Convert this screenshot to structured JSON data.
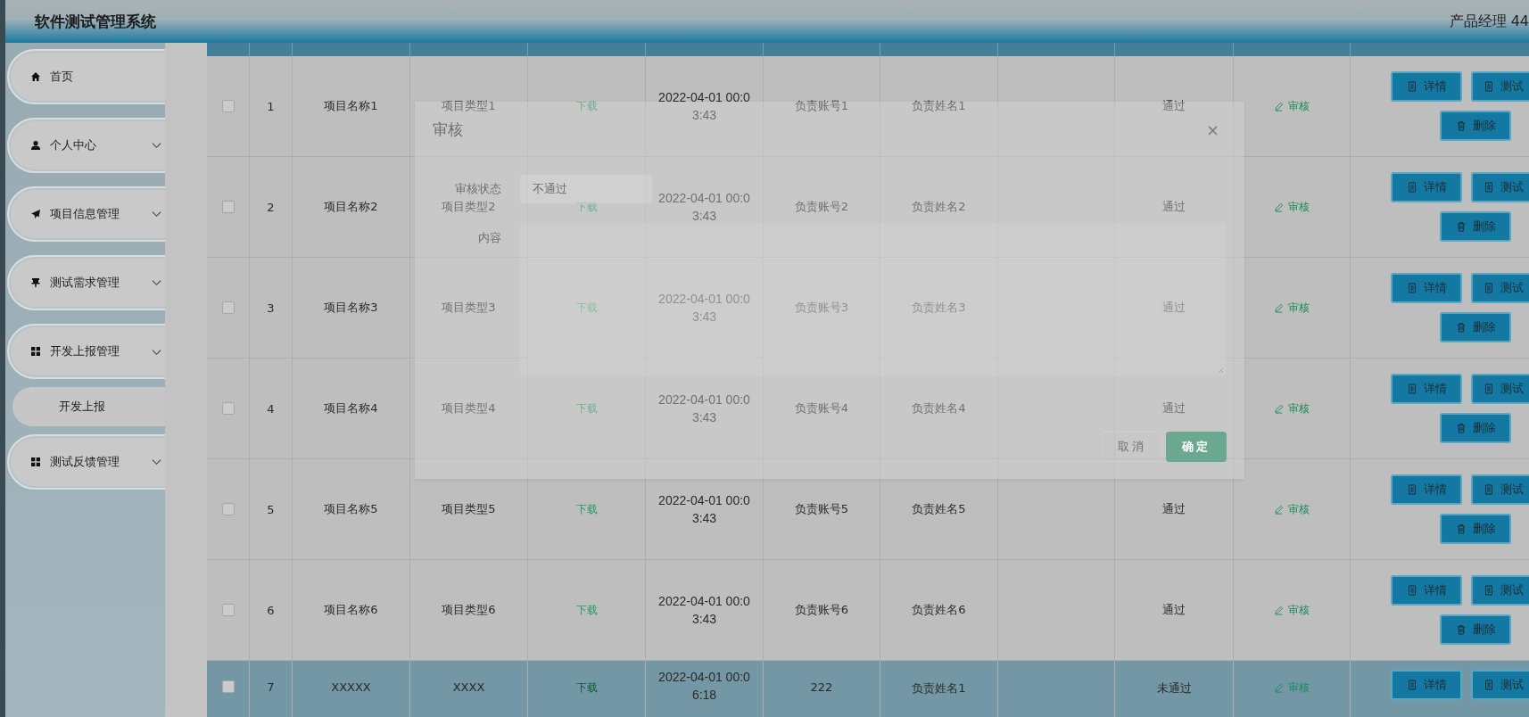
{
  "header": {
    "title": "软件测试管理系统",
    "user": "产品经理 44"
  },
  "sidebar": {
    "items": [
      {
        "label": "首页",
        "expandable": false
      },
      {
        "label": "个人中心",
        "expandable": true,
        "expanded": false
      },
      {
        "label": "项目信息管理",
        "expandable": true,
        "expanded": false
      },
      {
        "label": "测试需求管理",
        "expandable": true,
        "expanded": false
      },
      {
        "label": "开发上报管理",
        "expandable": true,
        "expanded": true,
        "children": [
          {
            "label": "开发上报"
          }
        ]
      },
      {
        "label": "测试反馈管理",
        "expandable": true,
        "expanded": false
      }
    ]
  },
  "table": {
    "rows": [
      {
        "checked": false,
        "selected": false,
        "index": "1",
        "name": "项目名称1",
        "type": "项目类型1",
        "file": "下载",
        "time": "2022-04-01 00:03:43",
        "account": "负责账号1",
        "person": "负责姓名1",
        "status": "通过",
        "review": "审核",
        "actions": [
          "详情",
          "测试",
          "删除"
        ]
      },
      {
        "checked": false,
        "selected": false,
        "index": "2",
        "name": "项目名称2",
        "type": "项目类型2",
        "file": "下载",
        "time": "2022-04-01 00:03:43",
        "account": "负责账号2",
        "person": "负责姓名2",
        "status": "通过",
        "review": "审核",
        "actions": [
          "详情",
          "测试",
          "删除"
        ]
      },
      {
        "checked": false,
        "selected": false,
        "index": "3",
        "name": "项目名称3",
        "type": "项目类型3",
        "file": "下载",
        "time": "2022-04-01 00:03:43",
        "account": "负责账号3",
        "person": "负责姓名3",
        "status": "通过",
        "review": "审核",
        "actions": [
          "详情",
          "测试",
          "删除"
        ]
      },
      {
        "checked": false,
        "selected": false,
        "index": "4",
        "name": "项目名称4",
        "type": "项目类型4",
        "file": "下载",
        "time": "2022-04-01 00:03:43",
        "account": "负责账号4",
        "person": "负责姓名4",
        "status": "通过",
        "review": "审核",
        "actions": [
          "详情",
          "测试",
          "删除"
        ]
      },
      {
        "checked": false,
        "selected": false,
        "index": "5",
        "name": "项目名称5",
        "type": "项目类型5",
        "file": "下载",
        "time": "2022-04-01 00:03:43",
        "account": "负责账号5",
        "person": "负责姓名5",
        "status": "通过",
        "review": "审核",
        "actions": [
          "详情",
          "测试",
          "删除"
        ]
      },
      {
        "checked": false,
        "selected": false,
        "index": "6",
        "name": "项目名称6",
        "type": "项目类型6",
        "file": "下载",
        "time": "2022-04-01 00:03:43",
        "account": "负责账号6",
        "person": "负责姓名6",
        "status": "通过",
        "review": "审核",
        "actions": [
          "详情",
          "测试",
          "删除"
        ]
      },
      {
        "checked": false,
        "selected": true,
        "index": "7",
        "name": "XXXXX",
        "type": "XXXX",
        "file": "下载",
        "time": "2022-04-01 00:06:18",
        "account": "222",
        "person": "负责姓名1",
        "status": "未通过",
        "review": "审核",
        "actions": [
          "详情",
          "测试"
        ]
      }
    ]
  },
  "dialog": {
    "title": "审核",
    "close": "×",
    "fields": [
      {
        "kind": "select",
        "label": "审核状态",
        "value": "不通过"
      },
      {
        "kind": "textarea",
        "label": "内容"
      }
    ],
    "buttons": [
      {
        "kind": "plain",
        "label": "取消"
      },
      {
        "kind": "primary",
        "label": "确定"
      }
    ]
  }
}
